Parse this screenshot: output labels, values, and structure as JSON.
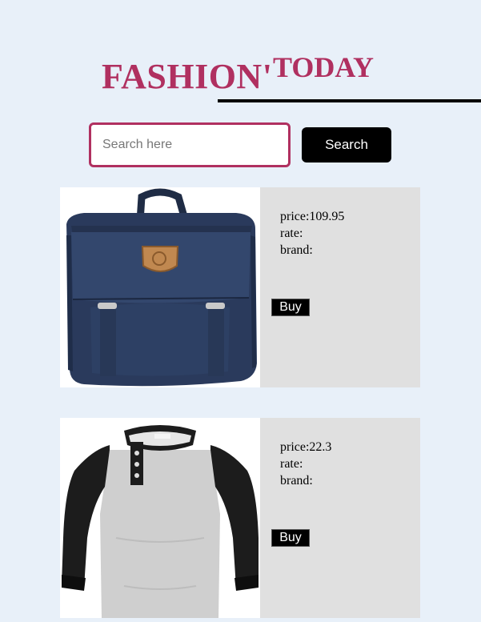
{
  "header": {
    "brand_part1": "FASHION'",
    "brand_part2": "TODAY"
  },
  "search": {
    "placeholder": "Search here",
    "button_label": "Search"
  },
  "products": [
    {
      "image_name": "navy-backpack-image",
      "price": "price:109.95",
      "rate": "rate:",
      "brand": "brand:",
      "buy_label": "Buy"
    },
    {
      "image_name": "raglan-henley-shirt-image",
      "price": "price:22.3",
      "rate": "rate:",
      "brand": "brand:",
      "buy_label": "Buy"
    }
  ],
  "colors": {
    "background": "#e8f0f9",
    "brand": "#b03060",
    "card": "#e0e0e0",
    "button": "#000000"
  }
}
